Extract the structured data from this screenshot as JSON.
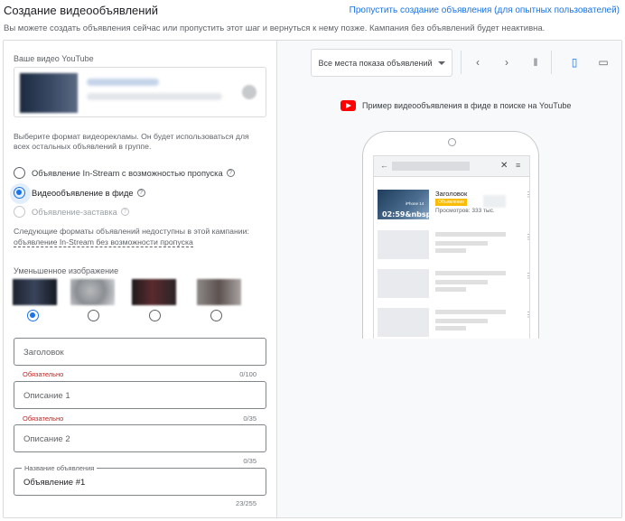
{
  "header": {
    "title": "Создание видеообъявлений",
    "skip_link": "Пропустить создание объявления (для опытных пользователей)",
    "description": "Вы можете создать объявления сейчас или пропустить этот шаг и вернуться к нему позже. Кампания без объявлений будет неактивна."
  },
  "left": {
    "video_label": "Ваше видео YouTube",
    "format_description": "Выберите формат видеорекламы. Он будет использоваться для всех остальных объявлений в группе.",
    "formats": [
      {
        "label": "Объявление In-Stream с возможностью пропуска",
        "state": "unselected"
      },
      {
        "label": "Видеообъявление в фиде",
        "state": "selected"
      },
      {
        "label": "Объявление-заставка",
        "state": "disabled"
      }
    ],
    "unavailable_text": "Следующие форматы объявлений недоступны в этой кампании:",
    "unavailable_link": "объявление In-Stream без возможности пропуска",
    "thumbnail_label": "Уменьшенное изображение",
    "thumbnails_selected_index": 0,
    "fields": {
      "headline": {
        "placeholder": "Заголовок",
        "error": "Обязательно",
        "count": "0/100"
      },
      "description1": {
        "placeholder": "Описание 1",
        "error": "Обязательно",
        "count": "0/35"
      },
      "description2": {
        "placeholder": "Описание 2",
        "count": "0/35"
      },
      "ad_name": {
        "legend": "Название объявления",
        "value": "Объявление #1",
        "count": "23/255"
      }
    }
  },
  "right": {
    "placement_dropdown": "Все места показа объявлений",
    "icons": [
      "chevron-left-icon",
      "chevron-right-icon",
      "split-view-icon",
      "mobile-icon",
      "desktop-icon"
    ],
    "preview_title": "Пример видеообъявления в фиде в поиске на YouTube",
    "ad": {
      "title": "Заголовок",
      "badge": "Объявление",
      "views": "Просмотров: 333 тыс.",
      "duration": "02:59&nbsp;",
      "thumb_label": "iPhone 14"
    }
  },
  "colors": {
    "accent": "#1a73e8",
    "error": "#c5221f",
    "youtube": "#ff0000",
    "ad_badge": "#fbbc04"
  }
}
